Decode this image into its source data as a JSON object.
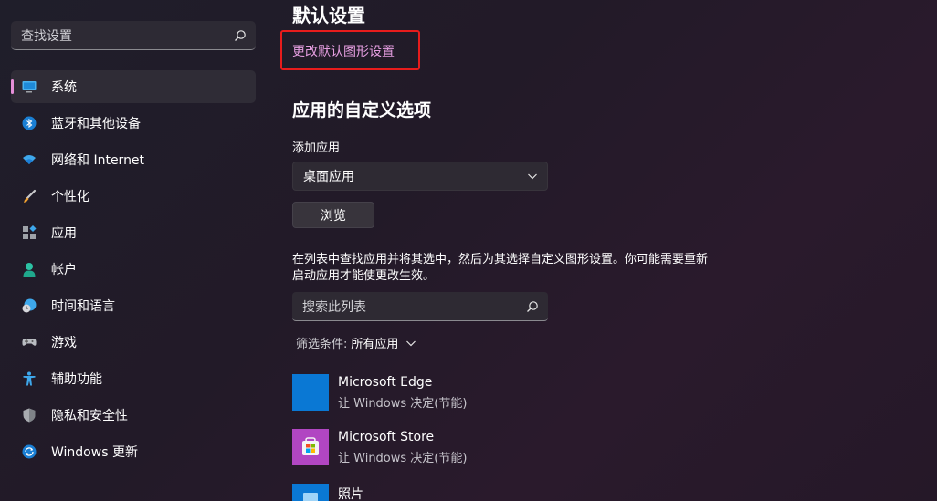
{
  "sidebar": {
    "search_placeholder": "查找设置",
    "items": [
      {
        "label": "系统",
        "icon": "monitor-icon",
        "active": true
      },
      {
        "label": "蓝牙和其他设备",
        "icon": "bluetooth-icon"
      },
      {
        "label": "网络和 Internet",
        "icon": "wifi-icon"
      },
      {
        "label": "个性化",
        "icon": "brush-icon"
      },
      {
        "label": "应用",
        "icon": "apps-icon"
      },
      {
        "label": "帐户",
        "icon": "person-icon"
      },
      {
        "label": "时间和语言",
        "icon": "clock-globe-icon"
      },
      {
        "label": "游戏",
        "icon": "gamepad-icon"
      },
      {
        "label": "辅助功能",
        "icon": "accessibility-icon"
      },
      {
        "label": "隐私和安全性",
        "icon": "shield-icon"
      },
      {
        "label": "Windows 更新",
        "icon": "update-icon"
      }
    ]
  },
  "main": {
    "default_heading": "默认设置",
    "default_link": "更改默认图形设置",
    "custom_heading": "应用的自定义选项",
    "add_app_label": "添加应用",
    "app_type_dropdown": "桌面应用",
    "browse_button": "浏览",
    "description": "在列表中查找应用并将其选中，然后为其选择自定义图形设置。你可能需要重新启动应用才能使更改生效。",
    "list_search_placeholder": "搜索此列表",
    "filter_label": "筛选条件:",
    "filter_value": "所有应用",
    "apps": [
      {
        "name": "Microsoft Edge",
        "status": "让 Windows 决定(节能)",
        "icon": "edge-icon"
      },
      {
        "name": "Microsoft Store",
        "status": "让 Windows 决定(节能)",
        "icon": "store-icon"
      },
      {
        "name": "照片",
        "status": "",
        "icon": "photos-icon"
      }
    ]
  },
  "colors": {
    "accent": "#e68fd8",
    "link": "#e59ee0",
    "highlight_box": "#e81c1c",
    "edge_tile": "#0a78d4",
    "store_tile": "#b146c2",
    "photos_tile": "#0a78d4"
  }
}
